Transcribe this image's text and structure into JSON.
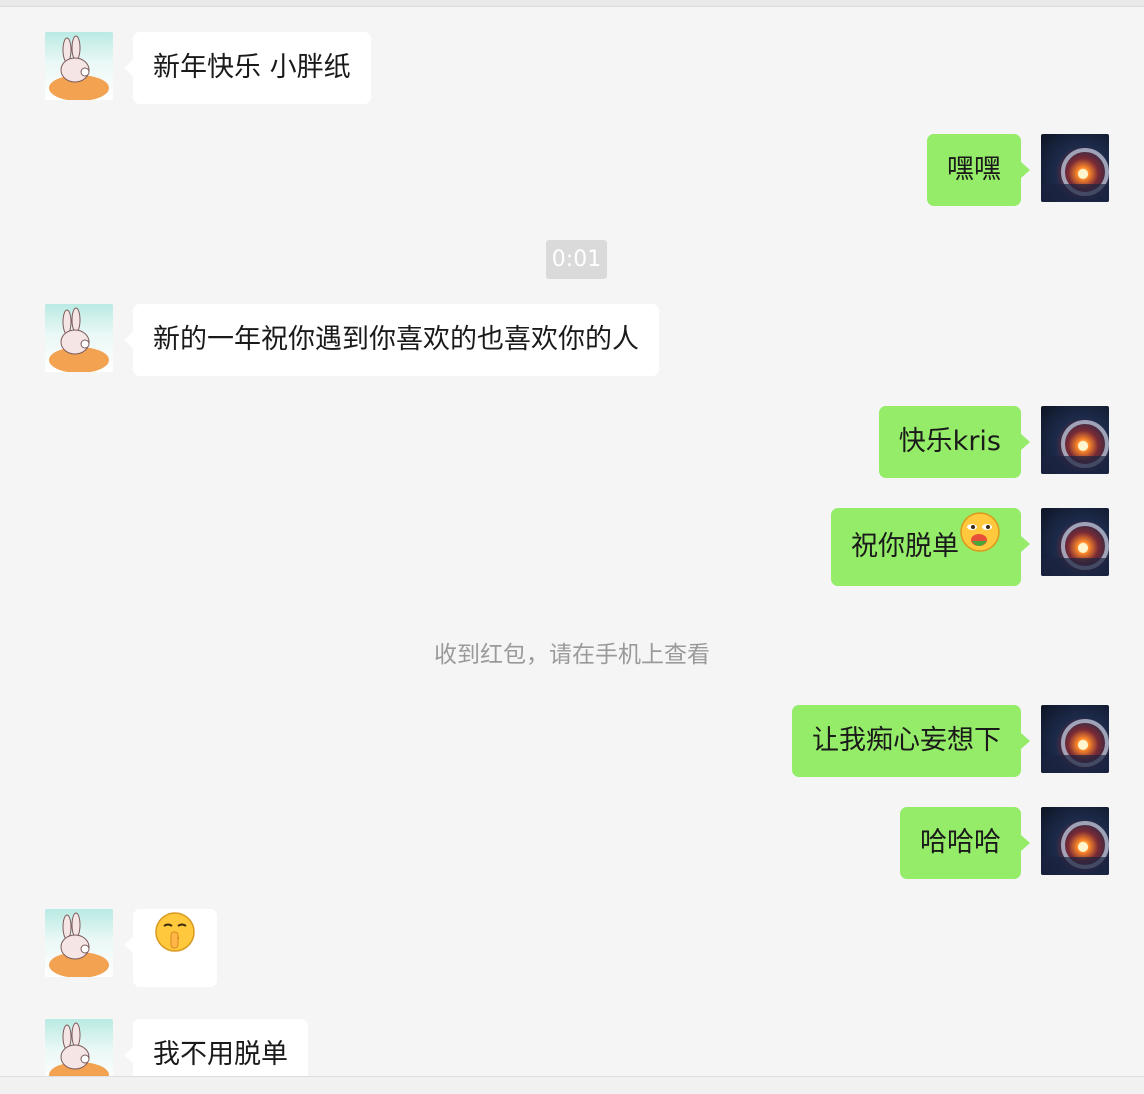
{
  "colors": {
    "background": "#f5f5f5",
    "self_bubble": "#95ec69",
    "other_bubble": "#ffffff",
    "notice_text": "#9a9a9a"
  },
  "messages": [
    {
      "side": "left",
      "text": "新年快乐 小胖纸",
      "avatar": "bunny-avatar"
    },
    {
      "side": "right",
      "text": "嘿嘿",
      "avatar": "space-avatar"
    },
    {
      "side": "left",
      "text": "新的一年祝你遇到你喜欢的也喜欢你的人",
      "avatar": "bunny-avatar"
    },
    {
      "side": "right",
      "text": "快乐kris",
      "avatar": "space-avatar"
    },
    {
      "side": "right",
      "text": "祝你脱单",
      "emoji": "sly-emoji",
      "avatar": "space-avatar"
    },
    {
      "side": "right",
      "text": "让我痴心妄想下",
      "avatar": "space-avatar"
    },
    {
      "side": "right",
      "text": "哈哈哈",
      "avatar": "space-avatar"
    },
    {
      "side": "left",
      "text": "",
      "emoji": "shush-emoji",
      "avatar": "bunny-avatar"
    },
    {
      "side": "left",
      "text": "我不用脱单",
      "avatar": "bunny-avatar"
    }
  ],
  "timestamp": "0:01",
  "system_notice": "收到红包，请在手机上查看"
}
